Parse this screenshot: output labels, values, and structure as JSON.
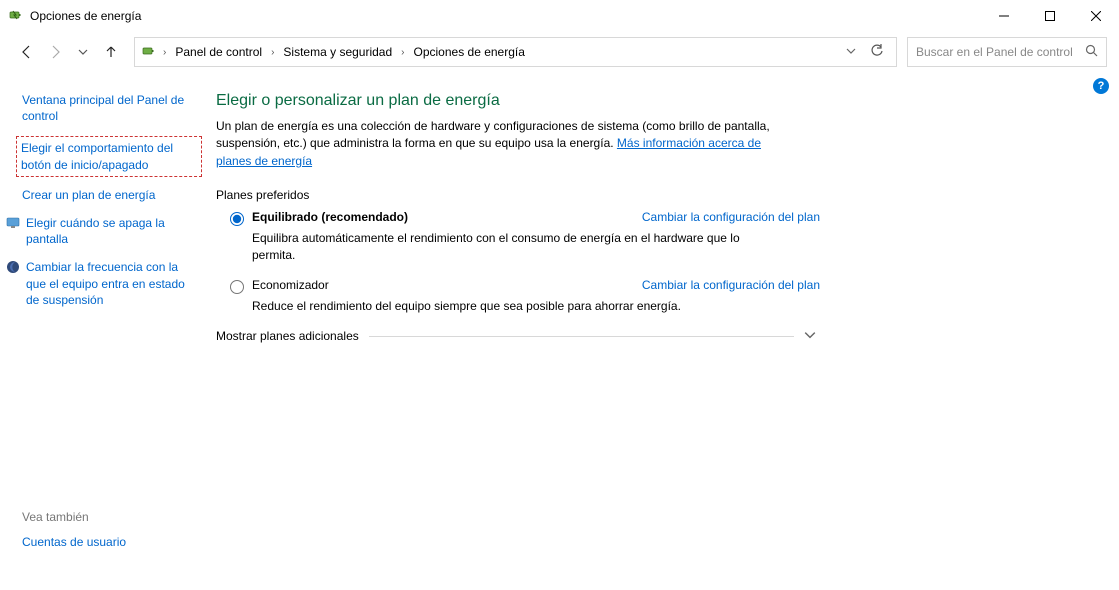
{
  "window": {
    "title": "Opciones de energía"
  },
  "breadcrumb": {
    "items": [
      "Panel de control",
      "Sistema y seguridad",
      "Opciones de energía"
    ]
  },
  "search": {
    "placeholder": "Buscar en el Panel de control"
  },
  "sidebar": {
    "items": [
      {
        "label": "Ventana principal del Panel de control"
      },
      {
        "label": "Elegir el comportamiento del botón de inicio/apagado",
        "highlight": true
      },
      {
        "label": "Crear un plan de energía"
      },
      {
        "label": "Elegir cuándo se apaga la pantalla",
        "icon": "monitor"
      },
      {
        "label": "Cambiar la frecuencia con la que el equipo entra en estado de suspensión",
        "icon": "moon"
      }
    ],
    "see_also_header": "Vea también",
    "see_also": [
      {
        "label": "Cuentas de usuario"
      }
    ]
  },
  "main": {
    "heading": "Elegir o personalizar un plan de energía",
    "intro_pre": "Un plan de energía es una colección de hardware y configuraciones de sistema (como brillo de pantalla, suspensión, etc.) que administra la forma en que su equipo usa la energía. ",
    "intro_link": "Más información acerca de planes de energía",
    "preferred_label": "Planes preferidos",
    "plans": [
      {
        "name": "Equilibrado (recomendado)",
        "desc": "Equilibra automáticamente el rendimiento con el consumo de energía en el hardware que lo permita.",
        "selected": true,
        "change_link": "Cambiar la configuración del plan"
      },
      {
        "name": "Economizador",
        "desc": "Reduce el rendimiento del equipo siempre que sea posible para ahorrar energía.",
        "selected": false,
        "change_link": "Cambiar la configuración del plan"
      }
    ],
    "more_plans": "Mostrar planes adicionales"
  }
}
